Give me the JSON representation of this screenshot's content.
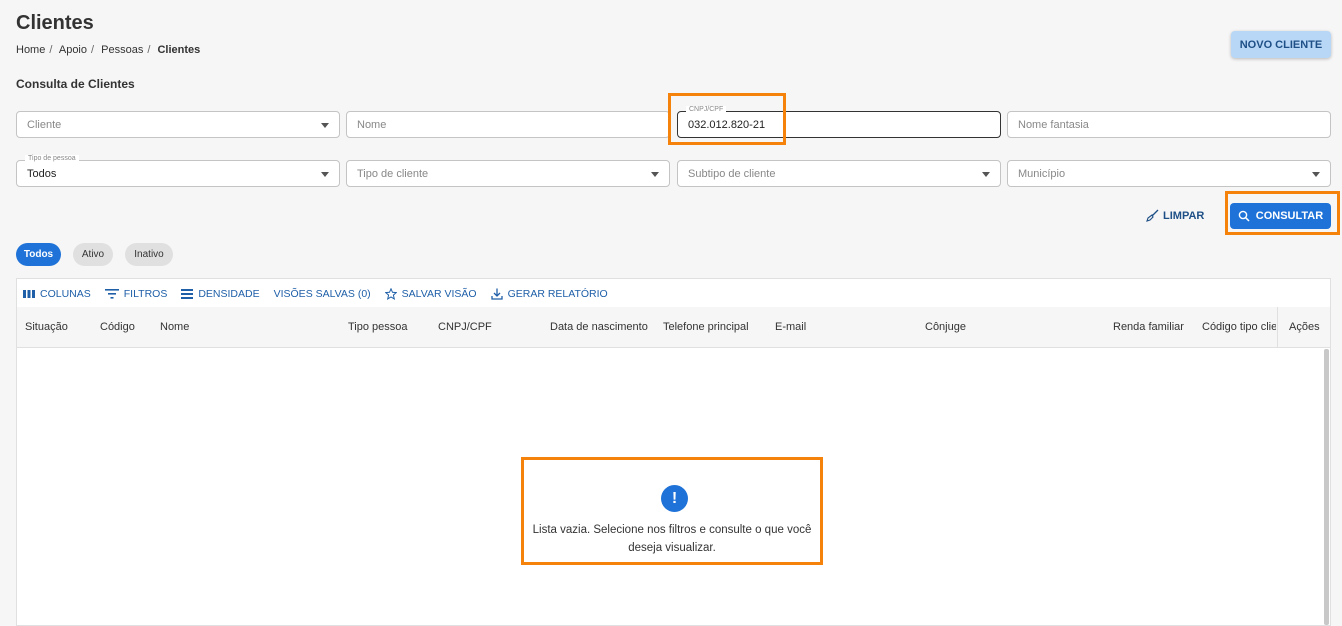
{
  "page": {
    "title": "Clientes",
    "section": "Consulta de Clientes"
  },
  "breadcrumb": [
    "Home",
    "Apoio",
    "Pessoas",
    "Clientes"
  ],
  "header": {
    "new_client_label": "NOVO CLIENTE"
  },
  "filters": {
    "cliente_placeholder": "Cliente",
    "nome_placeholder": "Nome",
    "cnpj_label": "CNPJ/CPF",
    "cnpj_value": "032.012.820-21",
    "nome_fantasia_placeholder": "Nome fantasia",
    "tipo_pessoa_label": "Tipo de pessoa",
    "tipo_pessoa_value": "Todos",
    "tipo_cliente_placeholder": "Tipo de cliente",
    "subtipo_cliente_placeholder": "Subtipo de cliente",
    "municipio_placeholder": "Município"
  },
  "actions": {
    "limpar": "LIMPAR",
    "consultar": "CONSULTAR"
  },
  "status_chips": [
    "Todos",
    "Ativo",
    "Inativo"
  ],
  "toolbar": {
    "colunas": "COLUNAS",
    "filtros": "FILTROS",
    "densidade": "DENSIDADE",
    "visoes": "VISÕES SALVAS (0)",
    "salvar": "SALVAR VISÃO",
    "relatorio": "GERAR RELATÓRIO"
  },
  "columns": [
    "Situação",
    "Código",
    "Nome",
    "Tipo pessoa",
    "CNPJ/CPF",
    "Data de nascimento",
    "Telefone principal",
    "E-mail",
    "Cônjuge",
    "Renda familiar",
    "Código tipo cliente",
    "Ações"
  ],
  "empty": {
    "icon": "!",
    "message": "Lista vazia. Selecione nos filtros e consulte o que você deseja visualizar."
  },
  "colors": {
    "primary": "#1f73d8",
    "highlight": "#f5820b"
  }
}
